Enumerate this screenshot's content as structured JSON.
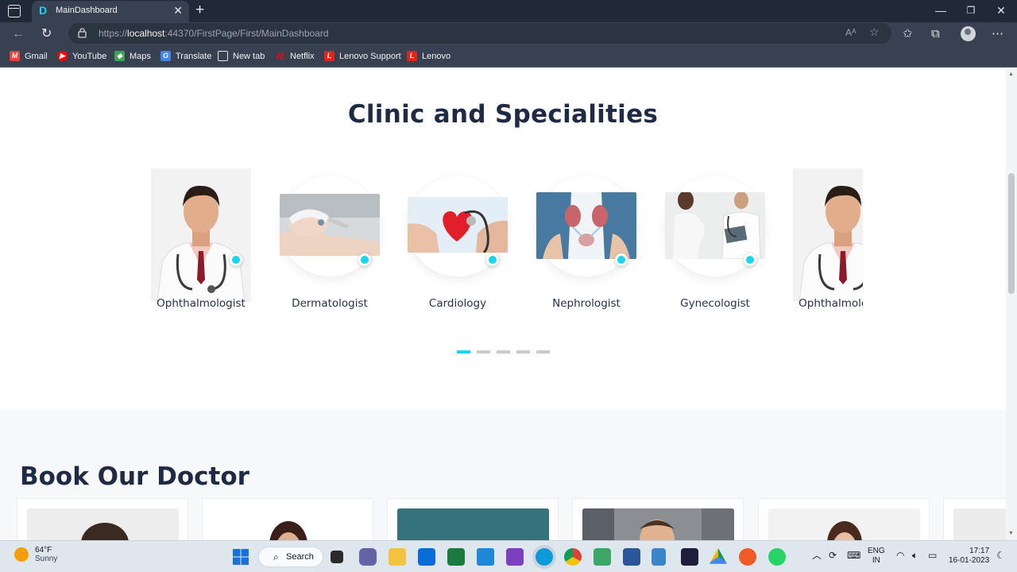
{
  "browser": {
    "tab_title": "MainDashboard",
    "tab_favicon_letter": "D",
    "url_prefix": "https://",
    "url_host": "localhost",
    "url_rest": ":44370/FirstPage/First/MainDashboard",
    "bookmarks": [
      {
        "label": "Gmail",
        "icon": "gmail-icon",
        "color": "#ea4335"
      },
      {
        "label": "YouTube",
        "icon": "youtube-icon",
        "color": "#ff0000"
      },
      {
        "label": "Maps",
        "icon": "maps-icon",
        "color": "#34a853"
      },
      {
        "label": "Translate",
        "icon": "translate-icon",
        "color": "#4285f4"
      },
      {
        "label": "New tab",
        "icon": "new-tab-icon",
        "color": "#e5e7eb"
      },
      {
        "label": "Netflix",
        "icon": "netflix-icon",
        "color": "#e50914"
      },
      {
        "label": "Lenovo Support",
        "icon": "lenovo-icon",
        "color": "#e2231a"
      },
      {
        "label": "Lenovo",
        "icon": "lenovo-icon",
        "color": "#e2231a"
      }
    ]
  },
  "specialities": {
    "title": "Clinic and Specialities",
    "items": [
      {
        "label": "Ophthalmologist",
        "image": "doctor-portrait"
      },
      {
        "label": "Dermatologist",
        "image": "facial-treatment"
      },
      {
        "label": "Cardiology",
        "image": "heart-stethoscope"
      },
      {
        "label": "Nephrologist",
        "image": "kidney-illustration"
      },
      {
        "label": "Gynecologist",
        "image": "pregnant-patient"
      },
      {
        "label": "Ophthalmologist",
        "image": "doctor-portrait"
      }
    ],
    "pager_count": 5,
    "pager_active": 0,
    "accent_color": "#19d5f0"
  },
  "book": {
    "title": "Book Our Doctor",
    "cards": 6
  },
  "taskbar": {
    "temperature": "64°F",
    "condition": "Sunny",
    "search_label": "Search",
    "lang_top": "ENG",
    "lang_bottom": "IN",
    "time": "17:17",
    "date": "16-01-2023"
  }
}
